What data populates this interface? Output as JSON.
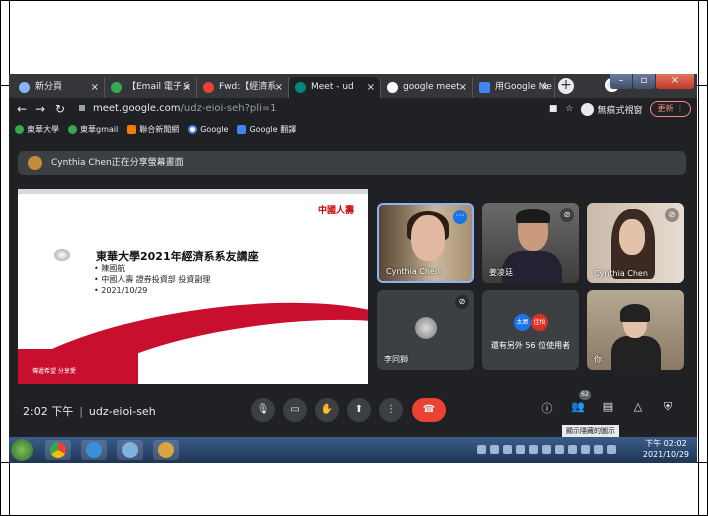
{
  "browser": {
    "tabs": [
      {
        "label": "新分頁",
        "icon": "chrome-newtab-icon",
        "color": "#8ab4f8"
      },
      {
        "label": "【Email 電子彡",
        "icon": "email-icon",
        "color": "#34a853"
      },
      {
        "label": "Fwd:【經濟系",
        "icon": "gmail-icon",
        "color": "#ea4335"
      },
      {
        "label": "Meet - ud",
        "icon": "meet-icon",
        "color": "#00897b"
      },
      {
        "label": "google meet",
        "icon": "google-icon",
        "color": "#fff"
      },
      {
        "label": "用Google Me",
        "icon": "doc-icon",
        "color": "#4285f4"
      }
    ],
    "tab_close": "×",
    "new_tab": "+",
    "url_host": "meet.google.com",
    "url_path": "/udz-eioi-seh?pli=1",
    "incognito_label": "無痕式視窗",
    "update_label": "更新",
    "bookmarks": [
      {
        "label": "東華大學",
        "color": "#34a853"
      },
      {
        "label": "東華gmail",
        "color": "#34a853"
      },
      {
        "label": "聯合新聞網",
        "color": "#f57c00"
      },
      {
        "label": "Google",
        "color": "#4285f4"
      },
      {
        "label": "Google 翻譯",
        "color": "#4285f4"
      }
    ]
  },
  "meet": {
    "banner_text": "Cynthia Chen正在分享螢幕畫面",
    "slide": {
      "logo": "中國人壽",
      "title": "東華大學2021年經濟系系友講座",
      "bullets": [
        "陳國航",
        "中國人壽 證券投資部 投資副理",
        "2021/10/29"
      ],
      "footer": "傳遞希望 分享愛"
    },
    "tiles": [
      {
        "name": "Cynthia Chen"
      },
      {
        "name": "姜凌廷"
      },
      {
        "name": "Cynthia Chen"
      },
      {
        "name": "李同獅"
      },
      {
        "name": "還有另外 56 位使用者",
        "avatar1": "太屌",
        "avatar2": "佳怡"
      },
      {
        "name": "你"
      }
    ],
    "time": "2:02 下午",
    "meeting_code": "udz-eioi-seh",
    "participant_count": "62",
    "tooltip": "顯示隱藏的圖示"
  },
  "taskbar": {
    "clock_time": "下午 02:02",
    "clock_date": "2021/10/29"
  },
  "colors": {
    "meet_bg": "#202124",
    "hangup": "#ea4335",
    "accent": "#8ab4f8"
  }
}
